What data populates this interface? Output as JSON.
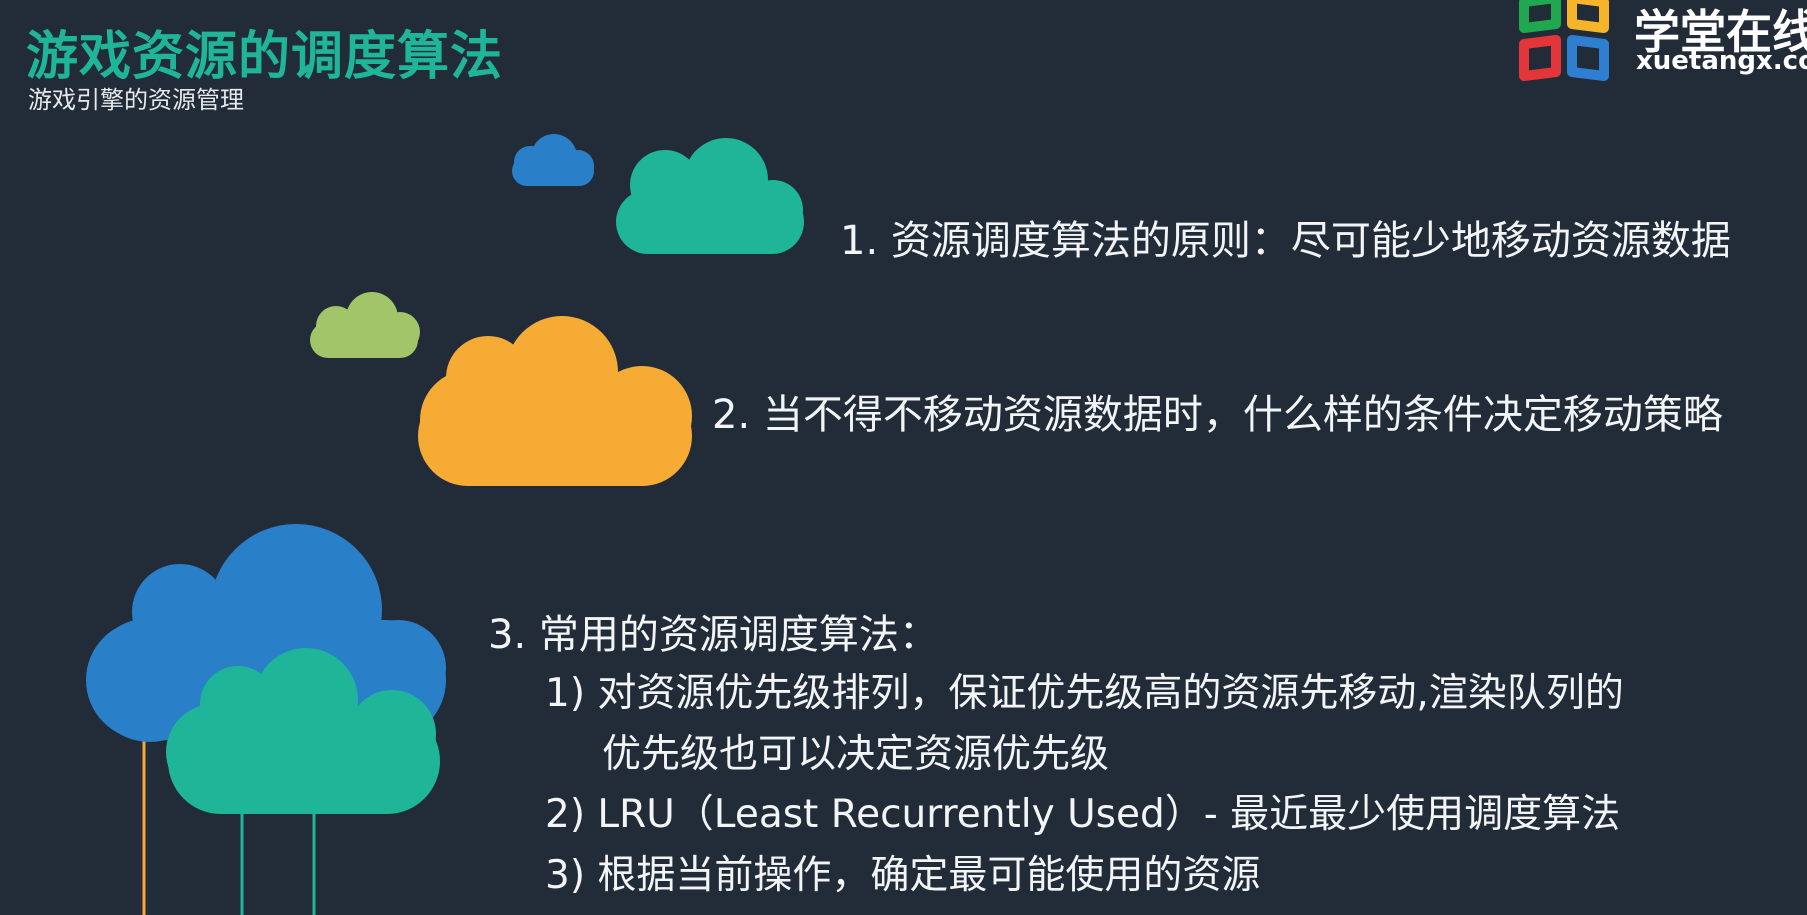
{
  "header": {
    "title": "游戏资源的调度算法",
    "subtitle": "游戏引擎的资源管理"
  },
  "logo": {
    "name_cn": "学堂在线",
    "name_en": "xuetangx.com",
    "colors": [
      "#1fa84f",
      "#f5b42a",
      "#e2363b",
      "#2f7fd0"
    ]
  },
  "content": {
    "point1": "1.  资源调度算法的原则：尽可能少地移动资源数据",
    "point2": "2.  当不得不移动资源数据时，什么样的条件决定移动策略",
    "point3": "3.  常用的资源调度算法：",
    "sub1_line1": "1)  对资源优先级排列，保证优先级高的资源先移动,渲染队列的",
    "sub1_line2": "优先级也可以决定资源优先级",
    "sub2": "2)  LRU（Least Recurrently Used）- 最近最少使用调度算法",
    "sub3": "3)  根据当前操作，确定最可能使用的资源"
  },
  "colors": {
    "background": "#222c38",
    "title": "#1fb598",
    "cloud_teal": "#1fb598",
    "cloud_blue": "#2a7fc9",
    "cloud_orange": "#f5ab34",
    "cloud_green": "#a3c56a"
  }
}
